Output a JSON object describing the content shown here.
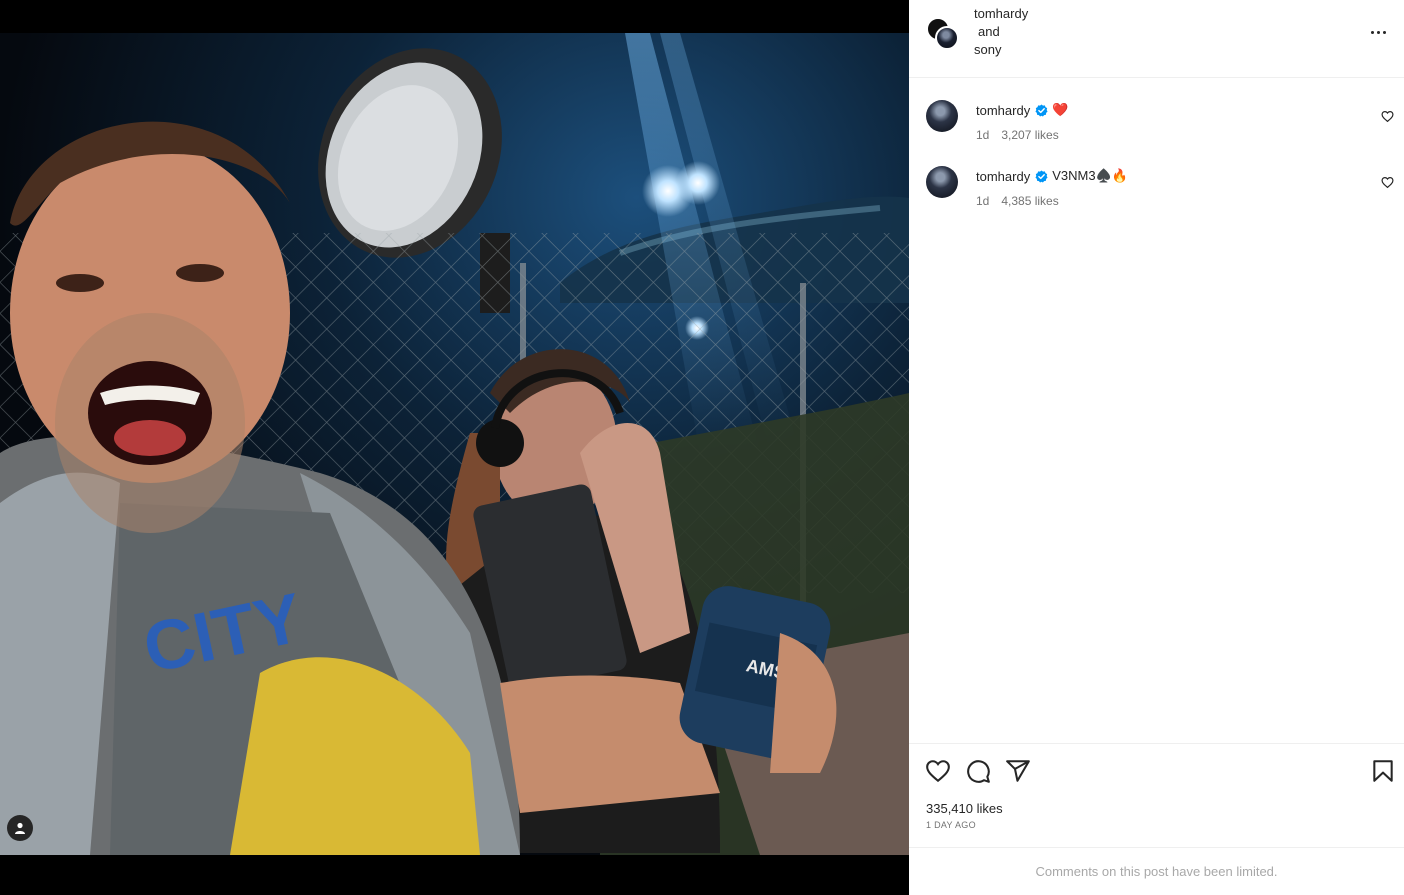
{
  "post": {
    "collaborators": [
      "tomhardy",
      "and",
      "sony"
    ],
    "more_label": "More options"
  },
  "comments": [
    {
      "username": "tomhardy",
      "text": "",
      "emoji": "❤️",
      "age": "1d",
      "likes": "3,207 likes"
    },
    {
      "username": "tomhardy",
      "text": "V3NM3♠️🔥",
      "emoji": "",
      "age": "1d",
      "likes": "4,385 likes"
    }
  ],
  "footer": {
    "likes": "335,410 likes",
    "time": "1 DAY AGO",
    "comments_limited": "Comments on this post have been limited."
  },
  "colors": {
    "verified": "#0095f6",
    "heart": "#ed4956",
    "secondary_text": "#737373"
  },
  "icons": [
    "heart-icon",
    "comment-icon",
    "share-icon",
    "save-icon",
    "verified-icon",
    "user-tag-icon"
  ]
}
